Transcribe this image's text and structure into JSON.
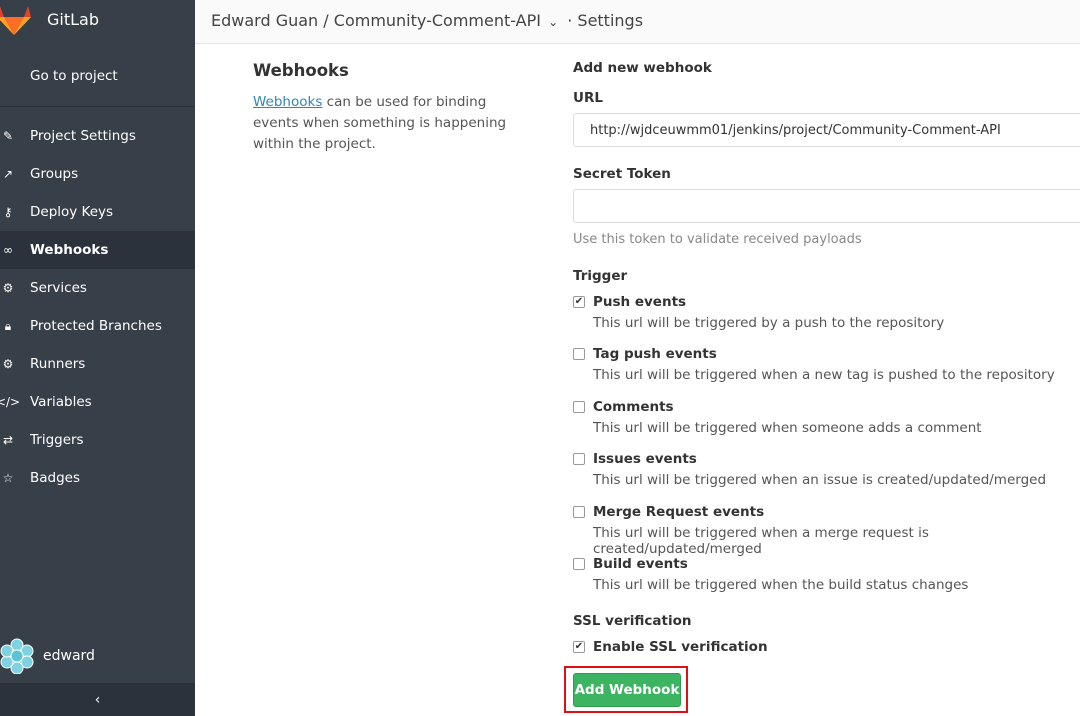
{
  "app": {
    "name": "GitLab"
  },
  "sidebar": {
    "goto_label": "Go to project",
    "items": [
      {
        "label": "Project Settings",
        "icon": "edit-icon",
        "glyph": "✎",
        "active": false
      },
      {
        "label": "Groups",
        "icon": "share-icon",
        "glyph": "↗",
        "active": false
      },
      {
        "label": "Deploy Keys",
        "icon": "key-icon",
        "glyph": "⚷",
        "active": false
      },
      {
        "label": "Webhooks",
        "icon": "link-icon",
        "glyph": "∞",
        "active": true
      },
      {
        "label": "Services",
        "icon": "cogs-icon",
        "glyph": "⚙",
        "active": false
      },
      {
        "label": "Protected Branches",
        "icon": "lock-icon",
        "glyph": "🔒︎",
        "active": false
      },
      {
        "label": "Runners",
        "icon": "gear-icon",
        "glyph": "⚙",
        "active": false
      },
      {
        "label": "Variables",
        "icon": "code-icon",
        "glyph": "</>",
        "active": false
      },
      {
        "label": "Triggers",
        "icon": "retweet-icon",
        "glyph": "⇄",
        "active": false
      },
      {
        "label": "Badges",
        "icon": "star-icon",
        "glyph": "☆",
        "active": false
      }
    ],
    "user_name": "edward",
    "collapse_glyph": "‹"
  },
  "header": {
    "owner": "Edward Guan",
    "separator": "/",
    "project": "Community-Comment-API",
    "suffix": "· Settings"
  },
  "intro": {
    "title": "Webhooks",
    "link_text": "Webhooks",
    "text": " can be used for binding events when something is happening within the project."
  },
  "form": {
    "heading": "Add new webhook",
    "url_label": "URL",
    "url_value": "http://wjdceuwmm01/jenkins/project/Community-Comment-API",
    "token_label": "Secret Token",
    "token_value": "",
    "token_hint": "Use this token to validate received payloads",
    "trigger_label": "Trigger",
    "triggers": [
      {
        "label": "Push events",
        "help": "This url will be triggered by a push to the repository",
        "checked": true
      },
      {
        "label": "Tag push events",
        "help": "This url will be triggered when a new tag is pushed to the repository",
        "checked": false
      },
      {
        "label": "Comments",
        "help": "This url will be triggered when someone adds a comment",
        "checked": false
      },
      {
        "label": "Issues events",
        "help": "This url will be triggered when an issue is created/updated/merged",
        "checked": false
      },
      {
        "label": "Merge Request events",
        "help": "This url will be triggered when a merge request is created/updated/merged",
        "checked": false
      },
      {
        "label": "Build events",
        "help": "This url will be triggered when the build status changes",
        "checked": false
      }
    ],
    "ssl_label": "SSL verification",
    "ssl_option": {
      "label": "Enable SSL verification",
      "checked": true
    },
    "submit_label": "Add Webhook"
  },
  "colors": {
    "sidebar_bg": "#373f49",
    "sidebar_active": "#2c323b",
    "button_green": "#3cb462",
    "highlight_red": "#dd1111",
    "link_blue": "#3084bb"
  }
}
